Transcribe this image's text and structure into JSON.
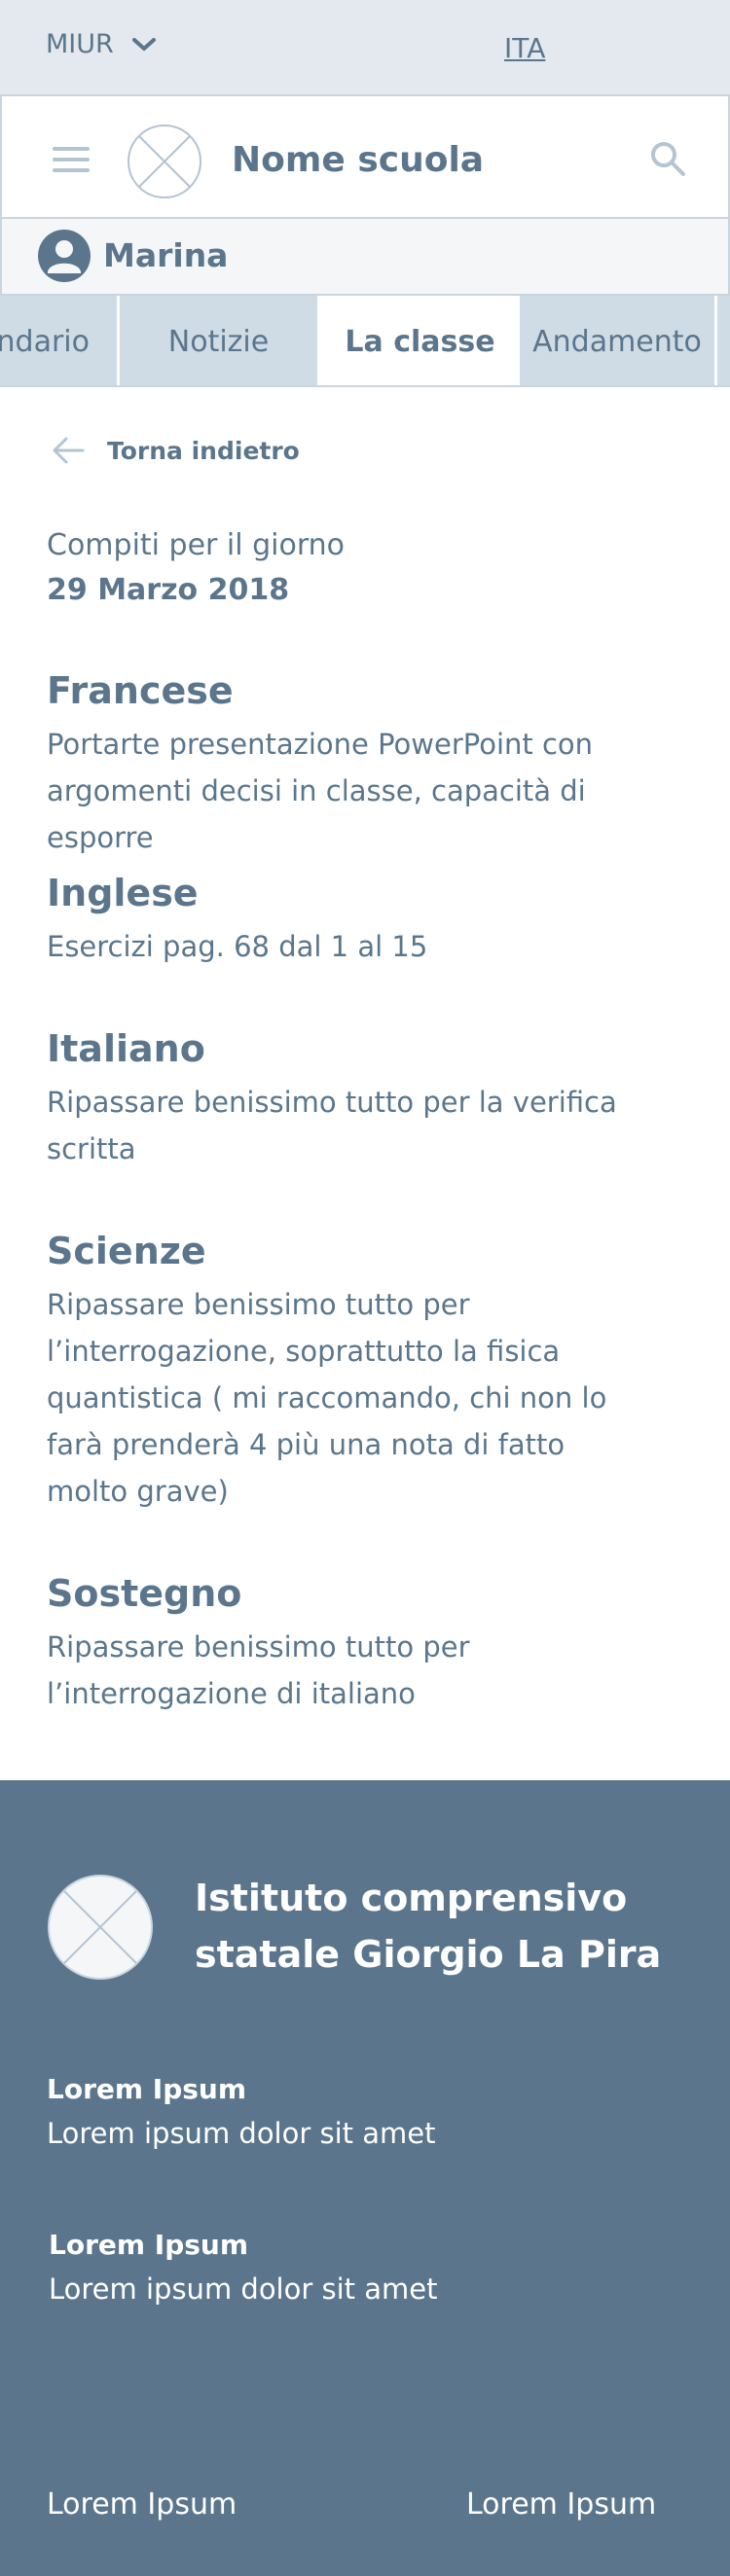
{
  "topbar": {
    "org_label": "MIUR",
    "language": "ITA"
  },
  "header": {
    "school_name": "Nome scuola"
  },
  "user": {
    "name": "Marina"
  },
  "tabs": [
    {
      "label": "Calendario"
    },
    {
      "label": "Notizie"
    },
    {
      "label": "La classe",
      "active": true
    },
    {
      "label": "Andamento"
    },
    {
      "label": ""
    }
  ],
  "back": {
    "label": "Torna indietro"
  },
  "homework": {
    "label": "Compiti per il giorno",
    "date": "29 Marzo 2018",
    "subjects": [
      {
        "name": "Francese",
        "text": "Portarte presentazione PowerPoint con argomenti decisi in classe, capacità di esporre"
      },
      {
        "name": "Inglese",
        "text": "Esercizi pag. 68 dal 1 al 15"
      },
      {
        "name": "Italiano",
        "text": "Ripassare benissimo tutto per la verifica scritta"
      },
      {
        "name": "Scienze",
        "text": "Ripassare benissimo tutto per l’interrogazione, soprattutto la fisica quantistica ( mi raccomando, chi non lo farà prenderà 4 più una nota di fatto molto grave)"
      },
      {
        "name": "Sostegno",
        "text": "Ripassare benissimo tutto per l’interrogazione di italiano"
      }
    ]
  },
  "footer": {
    "institute": "Istituto comprensivo statale Giorgio La Pira",
    "blocks": [
      {
        "heading": "Lorem Ipsum",
        "text": "Lorem ipsum dolor sit amet"
      },
      {
        "heading": "Lorem Ipsum",
        "text": "Lorem ipsum dolor sit amet"
      }
    ],
    "links": [
      "Lorem Ipsum",
      "Lorem Ipsum"
    ]
  },
  "colors": {
    "primary": "#5b768c",
    "topbar_bg": "#e4e9ef",
    "tab_bg": "#cfdbe5",
    "border": "#c9d5e0"
  },
  "icons": [
    "chevron-down-icon",
    "hamburger-menu-icon",
    "logo-placeholder-icon",
    "search-icon",
    "user-avatar-icon",
    "arrow-left-icon"
  ]
}
